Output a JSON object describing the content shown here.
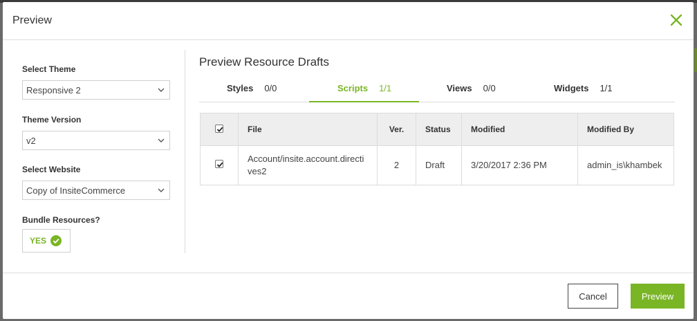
{
  "dialog": {
    "title": "Preview"
  },
  "left": {
    "theme_label": "Select Theme",
    "theme_value": "Responsive 2",
    "version_label": "Theme Version",
    "version_value": "v2",
    "website_label": "Select Website",
    "website_value": "Copy of InsiteCommerce",
    "bundle_label": "Bundle Resources?",
    "bundle_value": "YES"
  },
  "right": {
    "title": "Preview Resource Drafts",
    "tabs": [
      {
        "label": "Styles",
        "count": "0/0",
        "active": false
      },
      {
        "label": "Scripts",
        "count": "1/1",
        "active": true
      },
      {
        "label": "Views",
        "count": "0/0",
        "active": false
      },
      {
        "label": "Widgets",
        "count": "1/1",
        "active": false
      }
    ],
    "table": {
      "headers": {
        "file": "File",
        "ver": "Ver.",
        "status": "Status",
        "modified": "Modified",
        "modified_by": "Modified By"
      },
      "rows": [
        {
          "checked": true,
          "file": "Account/insite.account.directives2",
          "ver": "2",
          "status": "Draft",
          "modified": "3/20/2017 2:36 PM",
          "modified_by": "admin_is\\khambek"
        }
      ]
    }
  },
  "footer": {
    "cancel_label": "Cancel",
    "preview_label": "Preview"
  },
  "colors": {
    "accent": "#7ab526",
    "border": "#dcdcdc",
    "header_bg": "#eeeeee"
  }
}
